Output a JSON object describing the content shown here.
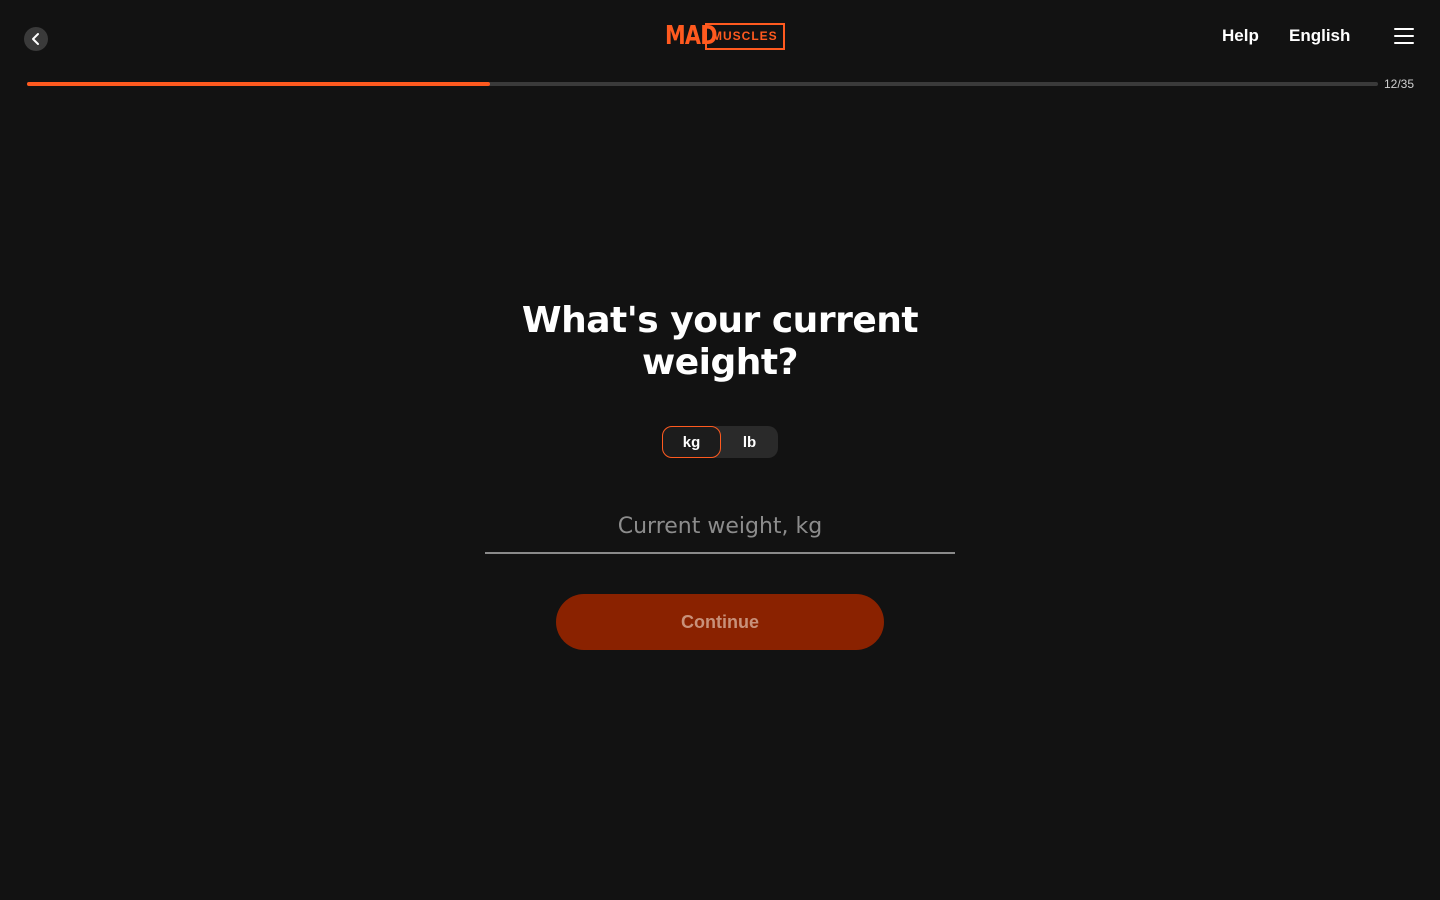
{
  "header": {
    "logo_left": "MAD",
    "logo_right": "MUSCLES",
    "help_label": "Help",
    "language_label": "English"
  },
  "progress": {
    "current": 12,
    "total": 35,
    "text": "12/35",
    "fraction": 0.343
  },
  "question": {
    "title": "What's your current weight?"
  },
  "units": {
    "options": [
      "kg",
      "lb"
    ],
    "selected": "kg"
  },
  "weight_input": {
    "placeholder": "Current weight, kg",
    "value": ""
  },
  "continue": {
    "label": "Continue"
  },
  "colors": {
    "accent": "#ff5a1f",
    "background": "#121212",
    "button_disabled": "#8a2200"
  }
}
